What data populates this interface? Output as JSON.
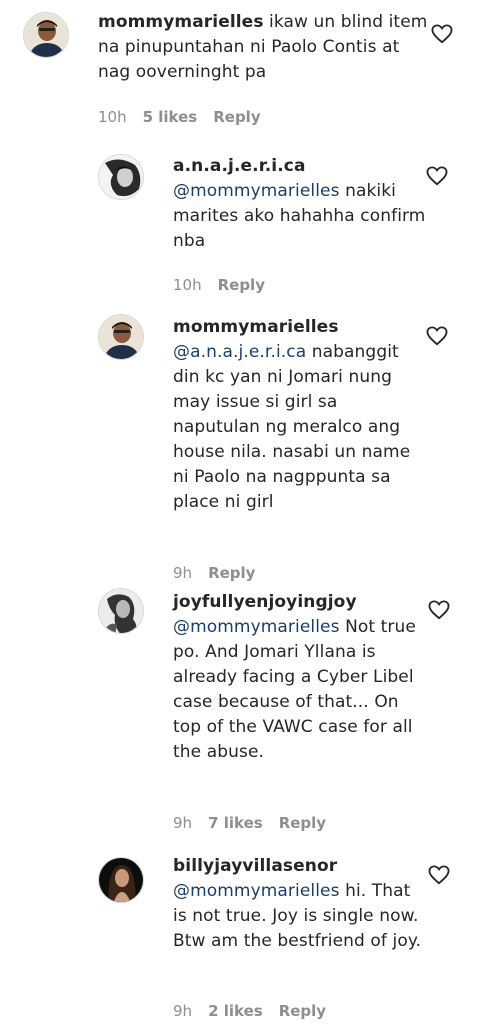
{
  "comments": [
    {
      "username": "mommymarielles",
      "mention": "",
      "text": "ikaw un blind item na pinupuntahan ni Paolo Contis at nag ooverninght pa",
      "time": "10h",
      "likes": "5 likes",
      "reply": "Reply",
      "avatar_icon": "profile-photo-icon"
    },
    {
      "username": "a.n.a.j.e.r.i.ca",
      "mention": "@mommymarielles",
      "text": "nakiki marites ako hahahha confirm nba",
      "time": "10h",
      "likes": "",
      "reply": "Reply",
      "avatar_icon": "profile-photo-icon"
    },
    {
      "username": "mommymarielles",
      "mention": "@a.n.a.j.e.r.i.ca",
      "text": "nabanggit din kc yan ni Jomari nung may issue si girl sa naputulan ng meralco ang house nila. nasabi un name ni Paolo na nagppunta sa place ni girl",
      "time": "9h",
      "likes": "",
      "reply": "Reply",
      "avatar_icon": "profile-photo-icon"
    },
    {
      "username": "joyfullyenjoyingjoy",
      "mention": "@mommymarielles",
      "text": "Not true po. And Jomari Yllana is already facing a Cyber Libel case because of that... On top of the VAWC case for all the abuse.",
      "time": "9h",
      "likes": "7 likes",
      "reply": "Reply",
      "avatar_icon": "profile-photo-icon"
    },
    {
      "username": "billyjayvillasenor",
      "mention": "@mommymarielles",
      "text": "hi. That is not true. Joy is single now. Btw am the bestfriend of joy.",
      "time": "9h",
      "likes": "2 likes",
      "reply": "Reply",
      "avatar_icon": "profile-photo-icon"
    }
  ],
  "colors": {
    "mention": "#1b3f6b",
    "meta": "#8e8e8e",
    "text": "#262626"
  }
}
